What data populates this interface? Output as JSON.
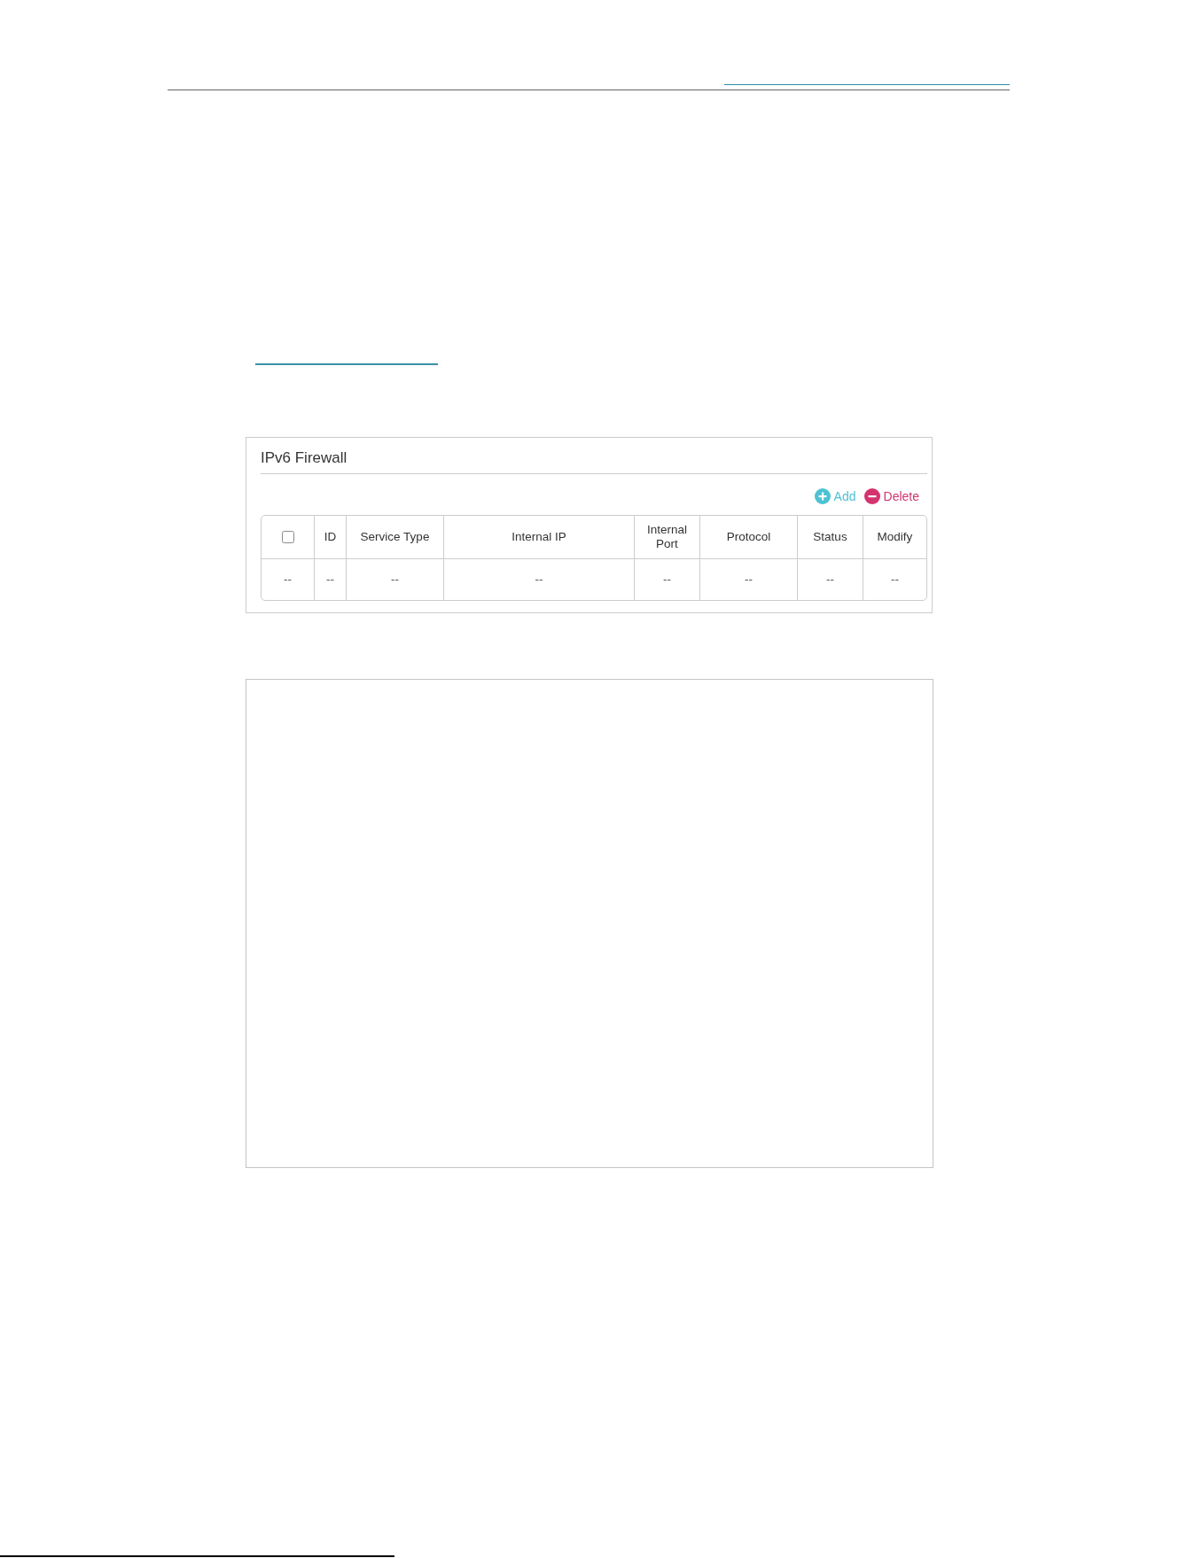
{
  "panel": {
    "title": "IPv6 Firewall",
    "actions": [
      {
        "kind": "add",
        "label": "Add"
      },
      {
        "kind": "delete",
        "label": "Delete"
      }
    ],
    "table": {
      "columns": [
        {
          "kind": "checkbox",
          "checked": false
        },
        {
          "kind": "text",
          "label": "ID"
        },
        {
          "kind": "text",
          "label": "Service Type"
        },
        {
          "kind": "text",
          "label": "Internal IP"
        },
        {
          "kind": "text",
          "label": "Internal Port"
        },
        {
          "kind": "text",
          "label": "Protocol"
        },
        {
          "kind": "text",
          "label": "Status"
        },
        {
          "kind": "text",
          "label": "Modify"
        }
      ],
      "rows": [
        {
          "cells": [
            "--",
            "--",
            "--",
            "--",
            "--",
            "--",
            "--",
            "--"
          ]
        }
      ]
    }
  }
}
